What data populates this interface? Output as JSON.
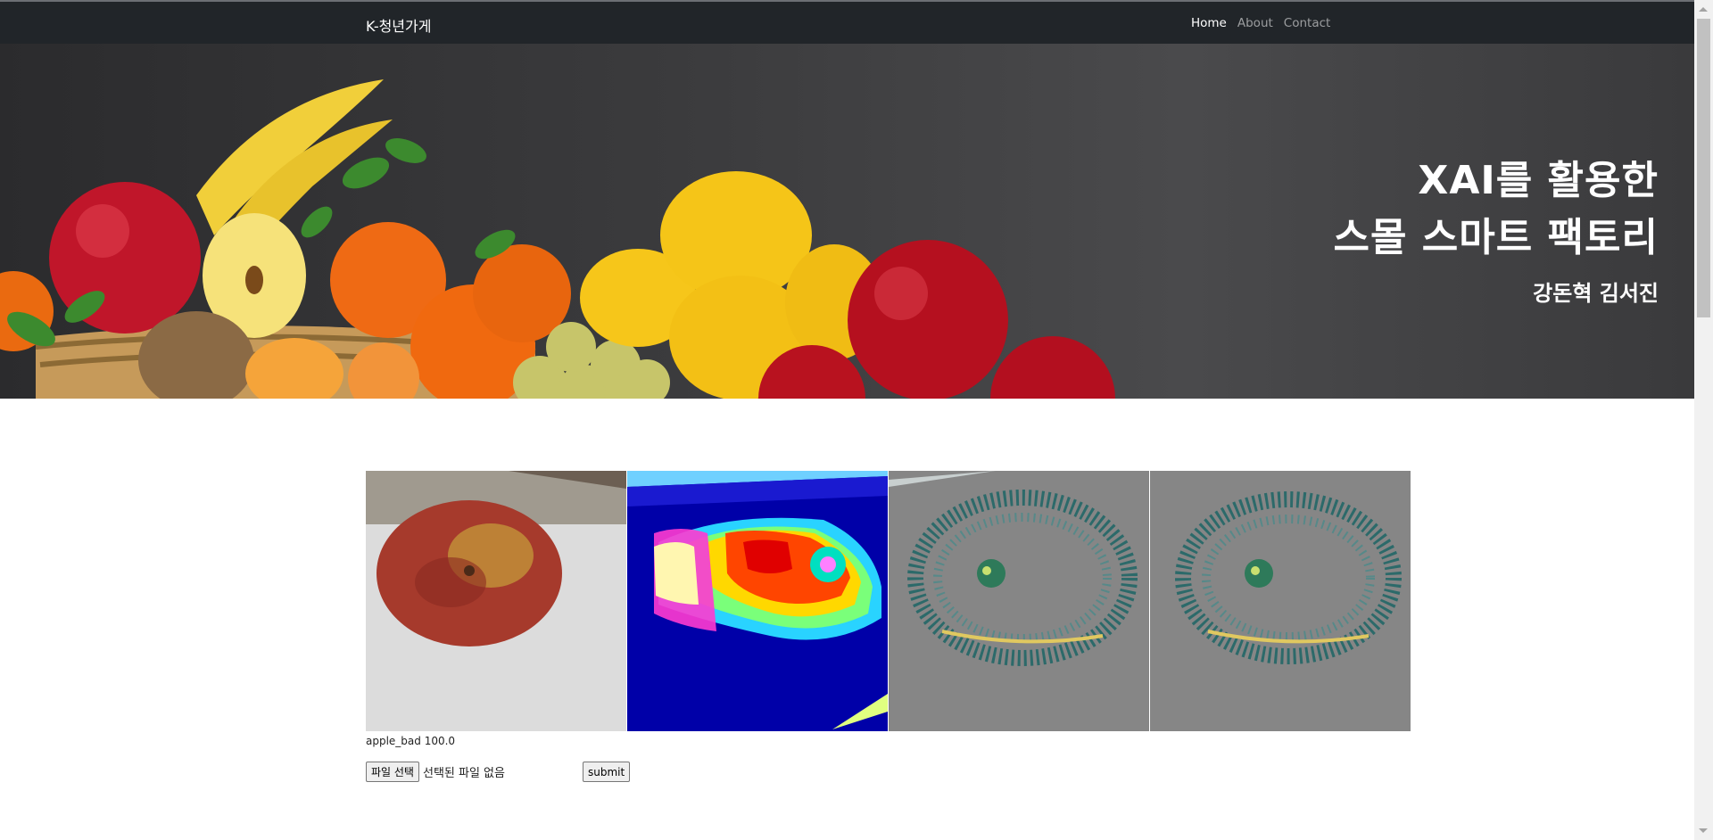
{
  "navbar": {
    "brand": "K-청년가게",
    "links": [
      {
        "label": "Home",
        "active": true
      },
      {
        "label": "About",
        "active": false
      },
      {
        "label": "Contact",
        "active": false
      }
    ]
  },
  "hero": {
    "title_line1": "XAI를 활용한",
    "title_line2": "스몰 스마트 팩토리",
    "authors": "강돈혁 김서진"
  },
  "results": {
    "panels": [
      {
        "kind": "input-photo",
        "icon": "apple-photo"
      },
      {
        "kind": "heatmap",
        "icon": "gradcam-heatmap"
      },
      {
        "kind": "guided-backprop",
        "icon": "saliency-map"
      },
      {
        "kind": "guided-gradcam",
        "icon": "saliency-map"
      }
    ],
    "prediction": "apple_bad 100.0"
  },
  "form": {
    "file_button_label": "파일 선택",
    "file_status": "선택된 파일 없음",
    "submit_label": "submit"
  },
  "colors": {
    "navbar_bg": "#212529",
    "hero_bg": "#3b3b3d",
    "heatmap_bg": "#0000a8",
    "saliency_bg": "#868686"
  }
}
